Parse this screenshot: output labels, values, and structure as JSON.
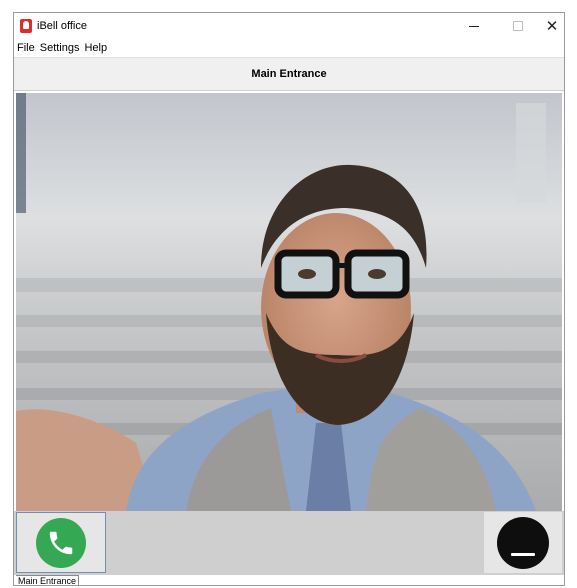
{
  "window": {
    "title": "iBell office"
  },
  "menu": {
    "items": [
      {
        "label": "File"
      },
      {
        "label": "Settings"
      },
      {
        "label": "Help"
      }
    ]
  },
  "header": {
    "title": "Main Entrance"
  },
  "controls": {
    "accept_icon": "phone-icon",
    "hangup_icon": "hangup-icon",
    "accept_color": "#34a853",
    "hangup_color": "#0e0e0e"
  },
  "status": {
    "tab_label": "Main Entrance"
  }
}
